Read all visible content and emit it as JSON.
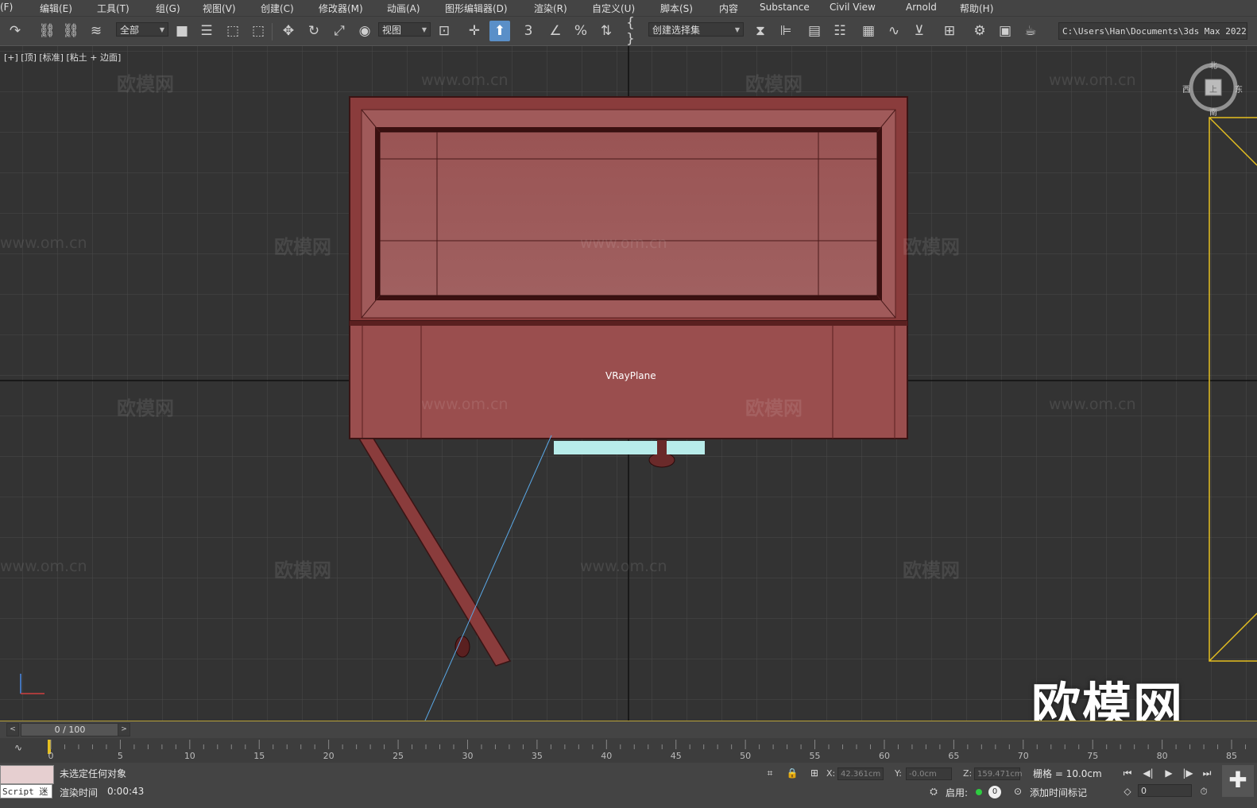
{
  "menubar": {
    "items": [
      "(F)",
      "编辑(E)",
      "工具(T)",
      "组(G)",
      "视图(V)",
      "创建(C)",
      "修改器(M)",
      "动画(A)",
      "图形编辑器(D)",
      "渲染(R)",
      "自定义(U)",
      "脚本(S)",
      "内容",
      "Substance",
      "Civil View",
      "Arnold",
      "帮助(H)"
    ]
  },
  "toolbar": {
    "selection_filter": "全部",
    "reference_coord": "视图",
    "named_selection": "创建选择集",
    "project_path": "C:\\Users\\Han\\Documents\\3ds Max 2022"
  },
  "viewport": {
    "label": "[+] [顶] [标准] [粘土 + 边面]",
    "object_label": "VRayPlane",
    "watermarks": [
      "欧模网",
      "www.om.cn"
    ],
    "big_watermark": "欧模网",
    "viewcube": {
      "north": "北",
      "south": "南",
      "east": "东",
      "west": "西",
      "face": "上"
    },
    "colors": {
      "model": "#8a3c3c",
      "selection_frame": "#e6c020",
      "highlight_plane": "#b8ecea",
      "camera_line": "#5aa8e6"
    }
  },
  "time_slider": {
    "frame_display": "0 / 100",
    "prev_label": "<",
    "next_label": ">"
  },
  "trackbar": {
    "ticks": [
      "0",
      "5",
      "10",
      "15",
      "20",
      "25",
      "30",
      "35",
      "40",
      "45",
      "50",
      "55",
      "60",
      "65",
      "70",
      "75",
      "80",
      "85"
    ]
  },
  "status": {
    "maxscript_label": "Script 迷",
    "selection_message": "未选定任何对象",
    "render_time_label": "渲染时间",
    "render_time_value": "0:00:43",
    "x_label": "X:",
    "x_value": "42.361cm",
    "y_label": "Y:",
    "y_value": "-0.0cm",
    "z_label": "Z:",
    "z_value": "159.471cm",
    "grid_label": "栅格 = 10.0cm",
    "enable_label": "启用:",
    "enable_count": "0",
    "add_time_tag": "添加时间标记",
    "frame_value": "0"
  }
}
